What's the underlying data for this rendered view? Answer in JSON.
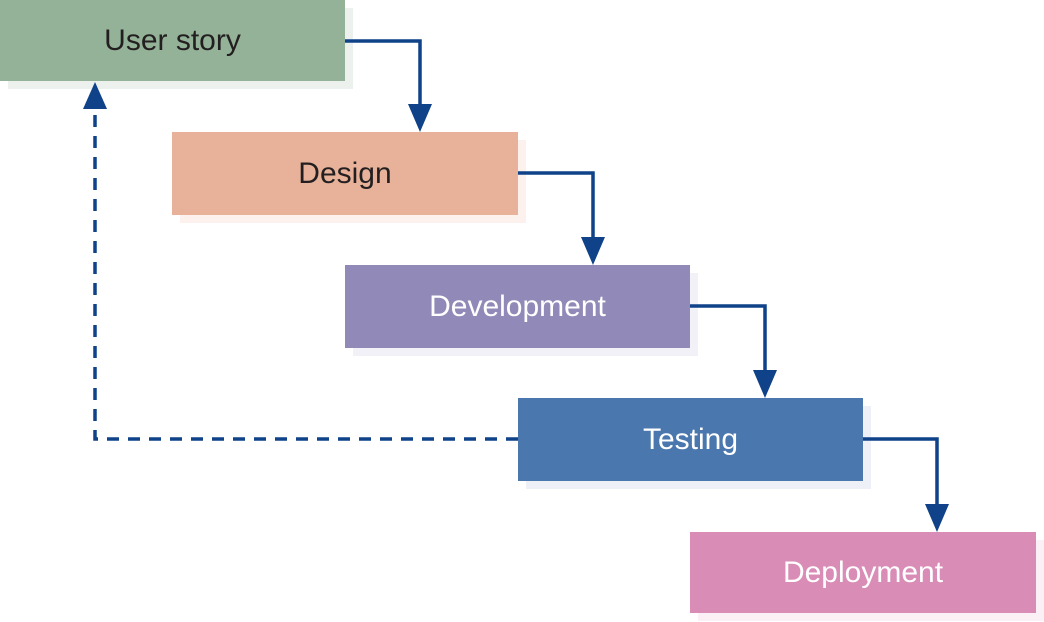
{
  "diagram": {
    "type": "waterfall-process",
    "stages": [
      {
        "id": "user-story",
        "label": "User story",
        "fill": "#94b298",
        "shadow": "#edf1ee",
        "text_color": "#231f20"
      },
      {
        "id": "design",
        "label": "Design",
        "fill": "#e8b19a",
        "shadow": "#fdf1ee",
        "text_color": "#231f20"
      },
      {
        "id": "development",
        "label": "Development",
        "fill": "#918ab9",
        "shadow": "#f1f1f7",
        "text_color": "#ffffff"
      },
      {
        "id": "testing",
        "label": "Testing",
        "fill": "#4a77ad",
        "shadow": "#edf0f7",
        "text_color": "#ffffff"
      },
      {
        "id": "deployment",
        "label": "Deployment",
        "fill": "#d98db6",
        "shadow": "#faf0f6",
        "text_color": "#ffffff"
      }
    ],
    "connectors": [
      {
        "from": "user-story",
        "to": "design",
        "style": "solid"
      },
      {
        "from": "design",
        "to": "development",
        "style": "solid"
      },
      {
        "from": "development",
        "to": "testing",
        "style": "solid"
      },
      {
        "from": "testing",
        "to": "deployment",
        "style": "solid"
      },
      {
        "from": "testing",
        "to": "user-story",
        "style": "dashed",
        "meaning": "feedback loop"
      }
    ],
    "arrow_color": "#0f4289"
  }
}
